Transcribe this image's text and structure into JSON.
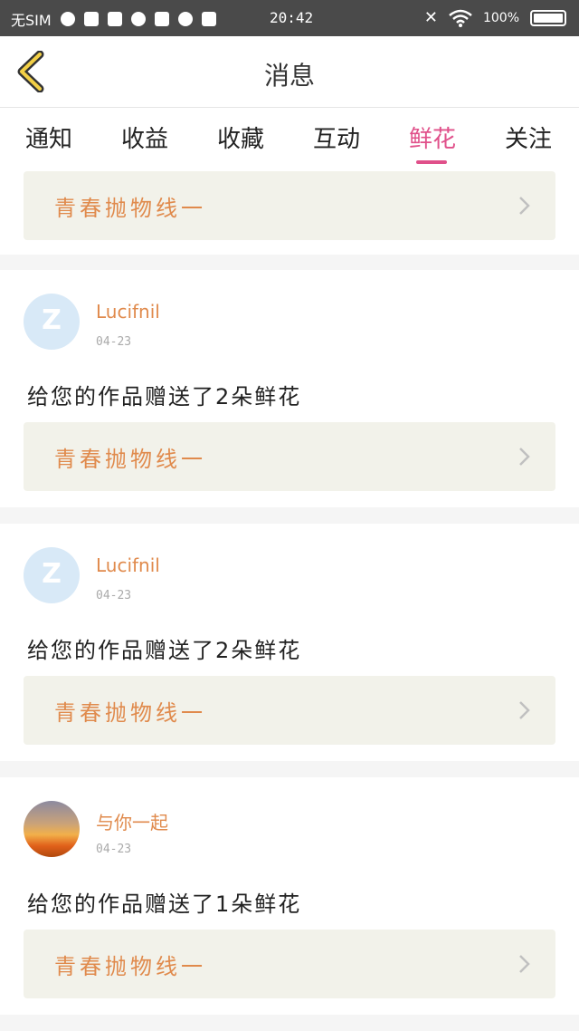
{
  "status_bar": {
    "carrier": "无SIM",
    "time": "20:42",
    "battery": "100"
  },
  "header": {
    "title": "消息",
    "back_icon": "chevron-left-icon"
  },
  "tabs": [
    {
      "label": "通知",
      "active": false
    },
    {
      "label": "收益",
      "active": false
    },
    {
      "label": "收藏",
      "active": false
    },
    {
      "label": "互动",
      "active": false
    },
    {
      "label": "鲜花",
      "active": true
    },
    {
      "label": "关注",
      "active": false
    }
  ],
  "colors": {
    "accent": "#e0508a",
    "username": "#e08a4c",
    "work_box_bg": "#f2f2ea"
  },
  "top_partial_card": {
    "work_title": "青春抛物线一"
  },
  "messages": [
    {
      "username": "Lucifnil",
      "date": "04-23",
      "text": "给您的作品赠送了2朵鲜花",
      "work_title": "青春抛物线一",
      "avatar": "default-avatar"
    },
    {
      "username": "Lucifnil",
      "date": "04-23",
      "text": "给您的作品赠送了2朵鲜花",
      "work_title": "青春抛物线一",
      "avatar": "default-avatar"
    },
    {
      "username": "与你一起",
      "date": "04-23",
      "text": "给您的作品赠送了1朵鲜花",
      "work_title": "青春抛物线一",
      "avatar": "sunset-photo"
    }
  ]
}
